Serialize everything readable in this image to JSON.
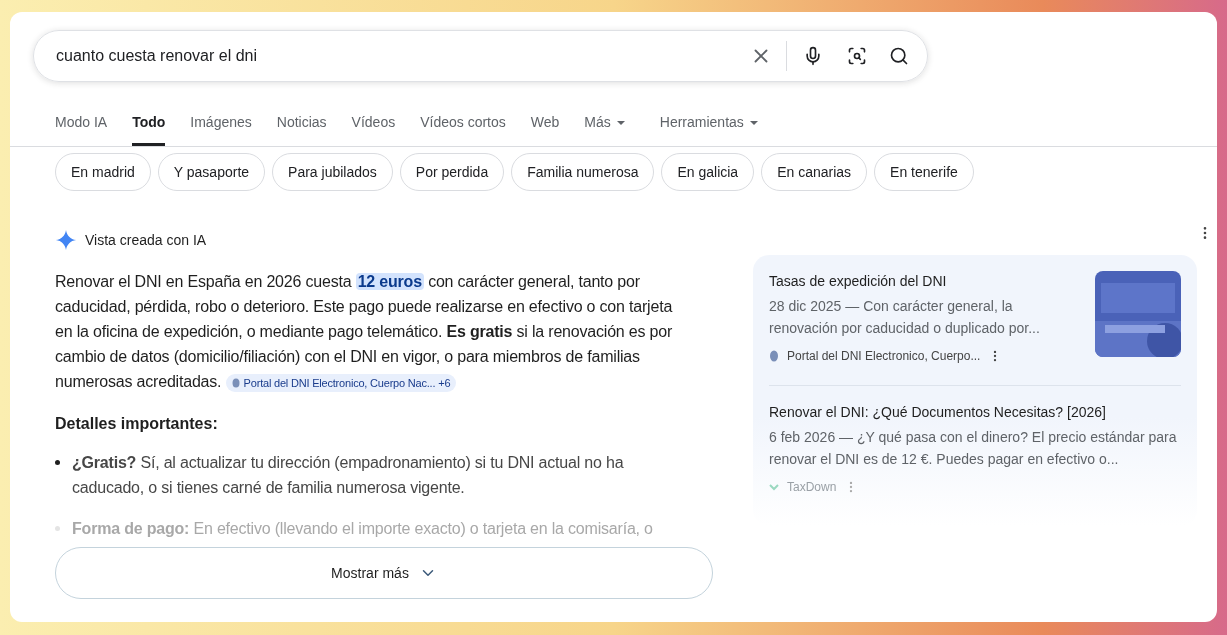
{
  "search": {
    "value": "cuanto cuesta renovar el dni"
  },
  "tabs": [
    {
      "label": "Modo IA",
      "selected": false,
      "dropdown": false
    },
    {
      "label": "Todo",
      "selected": true,
      "dropdown": false
    },
    {
      "label": "Imágenes",
      "selected": false,
      "dropdown": false
    },
    {
      "label": "Noticias",
      "selected": false,
      "dropdown": false
    },
    {
      "label": "Vídeos",
      "selected": false,
      "dropdown": false
    },
    {
      "label": "Vídeos cortos",
      "selected": false,
      "dropdown": false
    },
    {
      "label": "Web",
      "selected": false,
      "dropdown": false
    },
    {
      "label": "Más",
      "selected": false,
      "dropdown": true
    },
    {
      "label": "Herramientas",
      "selected": false,
      "dropdown": true
    }
  ],
  "chips": [
    "En madrid",
    "Y pasaporte",
    "Para jubilados",
    "Por perdida",
    "Familia numerosa",
    "En galicia",
    "En canarias",
    "En tenerife"
  ],
  "ai_overview": {
    "title": "Vista creada con IA",
    "paragraph": {
      "before": "Renovar el DNI en España en 2026 cuesta",
      "highlight": "12 euros",
      "after": "con carácter general, tanto por caducidad, pérdida, robo o deterioro. Este pago puede realizarse en efectivo o con tarjeta en la oficina de expedición, o mediante pago telemático. **Es gratis** si la renovación es por cambio de datos (domicilio/filiación) con el DNI en vigor, o para miembros de familias numerosas acreditadas.",
      "source_chip": "Portal del DNI Electronico, Cuerpo Nac... +6"
    },
    "heading": "Detalles importantes:",
    "bullets": [
      {
        "text": "**¿Gratis?** Sí, al actualizar tu dirección (empadronamiento) si tu DNI actual no ha caducado, o si tienes carné de familia numerosa vigente.",
        "faded": false
      },
      {
        "text": "**Forma de pago:** En efectivo (llevando el importe exacto) o tarjeta en la comisaría, o",
        "faded": true
      }
    ],
    "show_more": "Mostrar más"
  },
  "sources": [
    {
      "title": "Tasas de expedición del DNI",
      "snippet": "28 dic 2025 — Con carácter general, la renovación por caducidad o duplicado por...",
      "site": "Portal del DNI Electronico, Cuerpo...",
      "thumbnail": true,
      "faded": false
    },
    {
      "title": "Renovar el DNI: ¿Qué Documentos Necesitas? [2026]",
      "snippet": "6 feb 2026 — ¿Y qué pasa con el dinero? El precio estándar para renovar el DNI es de 12 €. Puedes pagar en efectivo o...",
      "site": "TaxDown",
      "thumbnail": false,
      "faded": true
    }
  ]
}
